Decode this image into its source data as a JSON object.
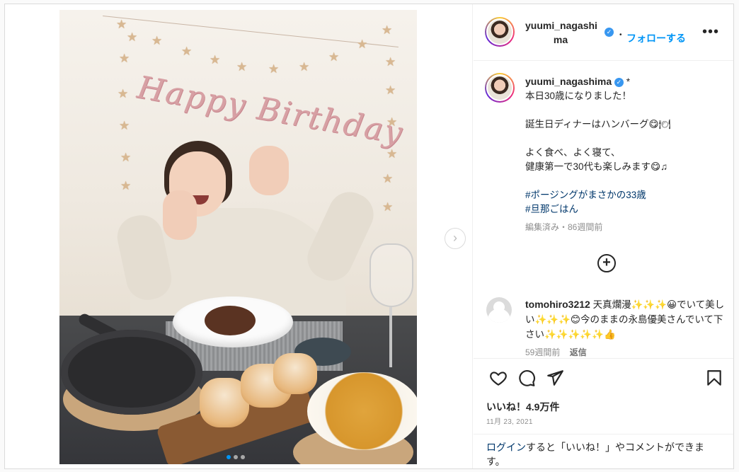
{
  "header": {
    "username_line1": "yuumi_nagashi",
    "username_line2": "ma",
    "follow_label": "フォローする",
    "bullet": "•"
  },
  "caption": {
    "username": "yuumi_nagashima",
    "suffix": "*",
    "line1": "本日30歳になりました！",
    "line2": "誕生日ディナーはハンバーグ😋🍽",
    "line3": "よく食べ、よく寝て、",
    "line4": "健康第一で30代も楽しみます😋♫",
    "hashtag1": "#ポージングがまさかの33歳",
    "hashtag2": "#旦那ごはん",
    "meta": "編集済み・86週間前"
  },
  "comment": {
    "username": "tomohiro3212",
    "text": "天真爛漫✨✨✨😀でいて美しい✨✨✨😊今のままの永島優美さんでいて下さい✨✨✨✨✨👍",
    "time": "59週間前",
    "reply_label": "返信"
  },
  "likes": {
    "label": "いいね！4.9万件",
    "date": "11月 23, 2021"
  },
  "login_prompt": {
    "link": "ログイン",
    "rest": "すると「いいね！」やコメントができます。"
  },
  "banner_text": "Happy Birthday",
  "carousel": {
    "slides": 3,
    "current": 1
  },
  "colors": {
    "accent": "#0095f6",
    "link": "#00376b",
    "muted": "#8e8e8e",
    "verified": "#3897f0"
  },
  "icons": [
    "heart-icon",
    "comment-icon",
    "share-icon",
    "bookmark-icon",
    "more-icon",
    "plus-circle-icon",
    "chevron-right-icon",
    "verified-icon"
  ]
}
